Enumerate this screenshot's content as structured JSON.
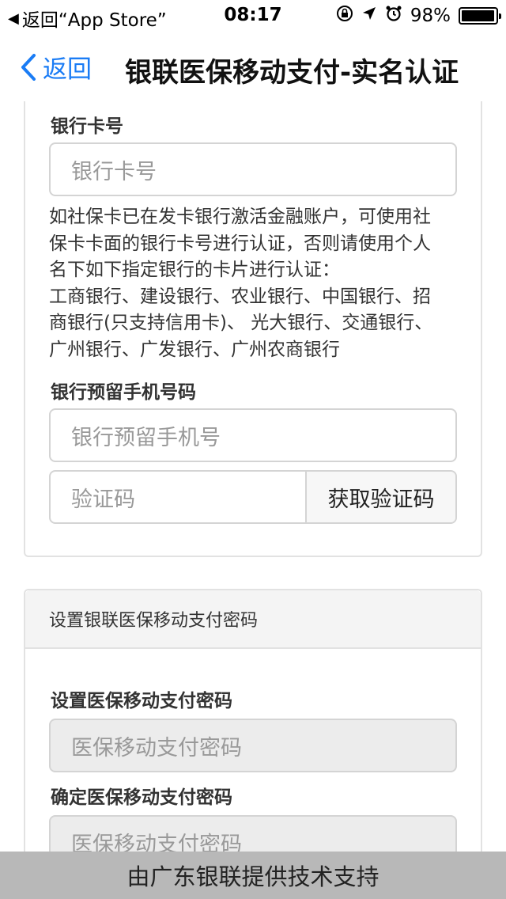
{
  "status_bar": {
    "back_app": "返回“App Store”",
    "time": "08:17",
    "battery_text": "98%",
    "battery_level": 0.98
  },
  "nav": {
    "back_label": "返回",
    "title": "银联医保移动支付-实名认证"
  },
  "bank_form": {
    "card_label": "银行卡号",
    "card_placeholder": "银行卡号",
    "description_lines": [
      "如社保卡已在发卡银行激活金融账户，可使用社",
      "保卡卡面的银行卡号进行认证，否则请使用个人",
      "名下如下指定银行的卡片进行认证：",
      "工商银行、建设银行、农业银行、中国银行、招",
      "商银行(只支持信用卡)、 光大银行、交通银行、",
      "广州银行、广发银行、广州农商银行"
    ],
    "phone_label": "银行预留手机号码",
    "phone_placeholder": "银行预留手机号",
    "code_placeholder": "验证码",
    "get_code_button": "获取验证码"
  },
  "password_form": {
    "section_title": "设置银联医保移动支付密码",
    "set_label": "设置医保移动支付密码",
    "set_placeholder": "医保移动支付密码",
    "confirm_label": "确定医保移动支付密码",
    "confirm_placeholder": "医保移动支付密码"
  },
  "footer": {
    "text": "由广东银联提供技术支持"
  }
}
